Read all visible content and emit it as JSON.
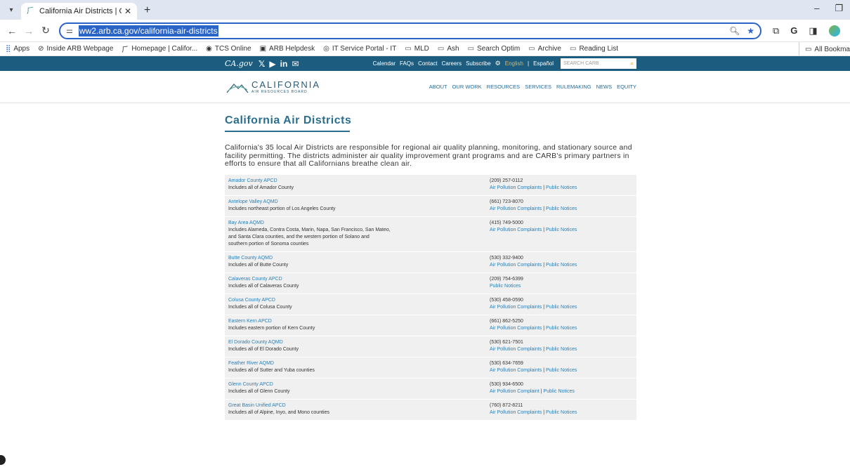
{
  "browser": {
    "tab_title": "California Air Districts | Californ",
    "url": "ww2.arb.ca.gov/california-air-districts",
    "bookmarks": [
      {
        "label": "Apps",
        "icon": "apps-grid-icon"
      },
      {
        "label": "Inside ARB Webpage",
        "icon": "globe-icon"
      },
      {
        "label": "Homepage | Califor...",
        "icon": "carb-icon"
      },
      {
        "label": "TCS Online",
        "icon": "tcs-icon"
      },
      {
        "label": "ARB Helpdesk",
        "icon": "helpdesk-icon"
      },
      {
        "label": "IT Service Portal - IT",
        "icon": "portal-icon"
      },
      {
        "label": "MLD",
        "icon": "folder-icon"
      },
      {
        "label": "Ash",
        "icon": "folder-icon"
      },
      {
        "label": "Search Optim",
        "icon": "folder-icon"
      },
      {
        "label": "Archive",
        "icon": "folder-icon"
      },
      {
        "label": "Reading List",
        "icon": "folder-icon"
      }
    ],
    "all_bookmarks": "All Bookma"
  },
  "site_header": {
    "links": [
      "Calendar",
      "FAQs",
      "Contact",
      "Careers",
      "Subscribe"
    ],
    "english": "English",
    "espanol": "Español",
    "search_placeholder": "SEARCH CARB"
  },
  "logo": {
    "line1": "CALIFORNIA",
    "line2": "AIR RESOURCES BOARD"
  },
  "nav": [
    "ABOUT",
    "OUR WORK",
    "RESOURCES",
    "SERVICES",
    "RULEMAKING",
    "NEWS",
    "EQUITY"
  ],
  "page": {
    "title": "California Air Districts",
    "intro": "California's 35 local Air Districts are responsible for regional air quality planning, monitoring, and stationary source and facility permitting. The districts administer air quality improvement grant programs and are CARB's primary partners in efforts to ensure that all Californians breathe clean air."
  },
  "districts": [
    {
      "name": "Amador County APCD",
      "desc": "Includes all of Amador County",
      "phone": "(209) 257-0112",
      "links": [
        "Air Pollution Complaints",
        "Public Notices"
      ]
    },
    {
      "name": "Antelope Valley AQMD",
      "desc": "Includes northeast portion of Los Angeles County",
      "phone": "(661) 723-8070",
      "links": [
        "Air Pollution Complaints",
        "Public Notices"
      ]
    },
    {
      "name": "Bay Area AQMD",
      "desc": "Includes Alameda, Contra Costa, Marin, Napa, San Francisco, San Mateo,",
      "desc2": "and Santa Clara counties, and the western portion of Solano and",
      "desc3": "southern portion of Sonoma counties",
      "phone": "(415) 749-5000",
      "links": [
        "Air Pollution Complaints",
        "Public Notices"
      ]
    },
    {
      "name": "Butte County AQMD",
      "desc": "Includes all of Butte County",
      "phone": "(530) 332-9400",
      "links": [
        "Air Pollution Complaints",
        "Public Notices"
      ]
    },
    {
      "name": "Calaveras County APCD",
      "desc": "Includes all of Calaveras County",
      "phone": "(209) 754-6399",
      "links": [
        "Public Notices"
      ]
    },
    {
      "name": "Colusa County APCD",
      "desc": "Includes all of Colusa County",
      "phone": "(530) 458-0590",
      "links": [
        "Air Pollution Complaints",
        "Public Notices"
      ]
    },
    {
      "name": "Eastern Kern APCD",
      "desc": "Includes eastern portion of Kern County",
      "phone": "(661) 862-5250",
      "links": [
        "Air Pollution Complaints",
        "Public Notices"
      ]
    },
    {
      "name": "El Dorado County AQMD",
      "desc": "Includes all of El Dorado County",
      "phone": "(530) 621-7501",
      "links": [
        "Air Pollution Complaints",
        "Public Notices"
      ]
    },
    {
      "name": "Feather River AQMD",
      "desc": "Includes all of Sutter and Yuba counties",
      "phone": "(530) 634-7659",
      "links": [
        "Air Pollution Complaints",
        "Public Notices"
      ]
    },
    {
      "name": "Glenn County APCD",
      "desc": "Includes all of Glenn County",
      "phone": "(530) 934-6500",
      "links": [
        "Air Pollution Complaint",
        "Public Notices"
      ]
    },
    {
      "name": "Great Basin Unified APCD",
      "desc": "Includes all of Alpine, Inyo, and Mono counties",
      "phone": "(760) 872-8211",
      "links": [
        "Air Pollution Complaints",
        "Public Notices"
      ]
    }
  ]
}
